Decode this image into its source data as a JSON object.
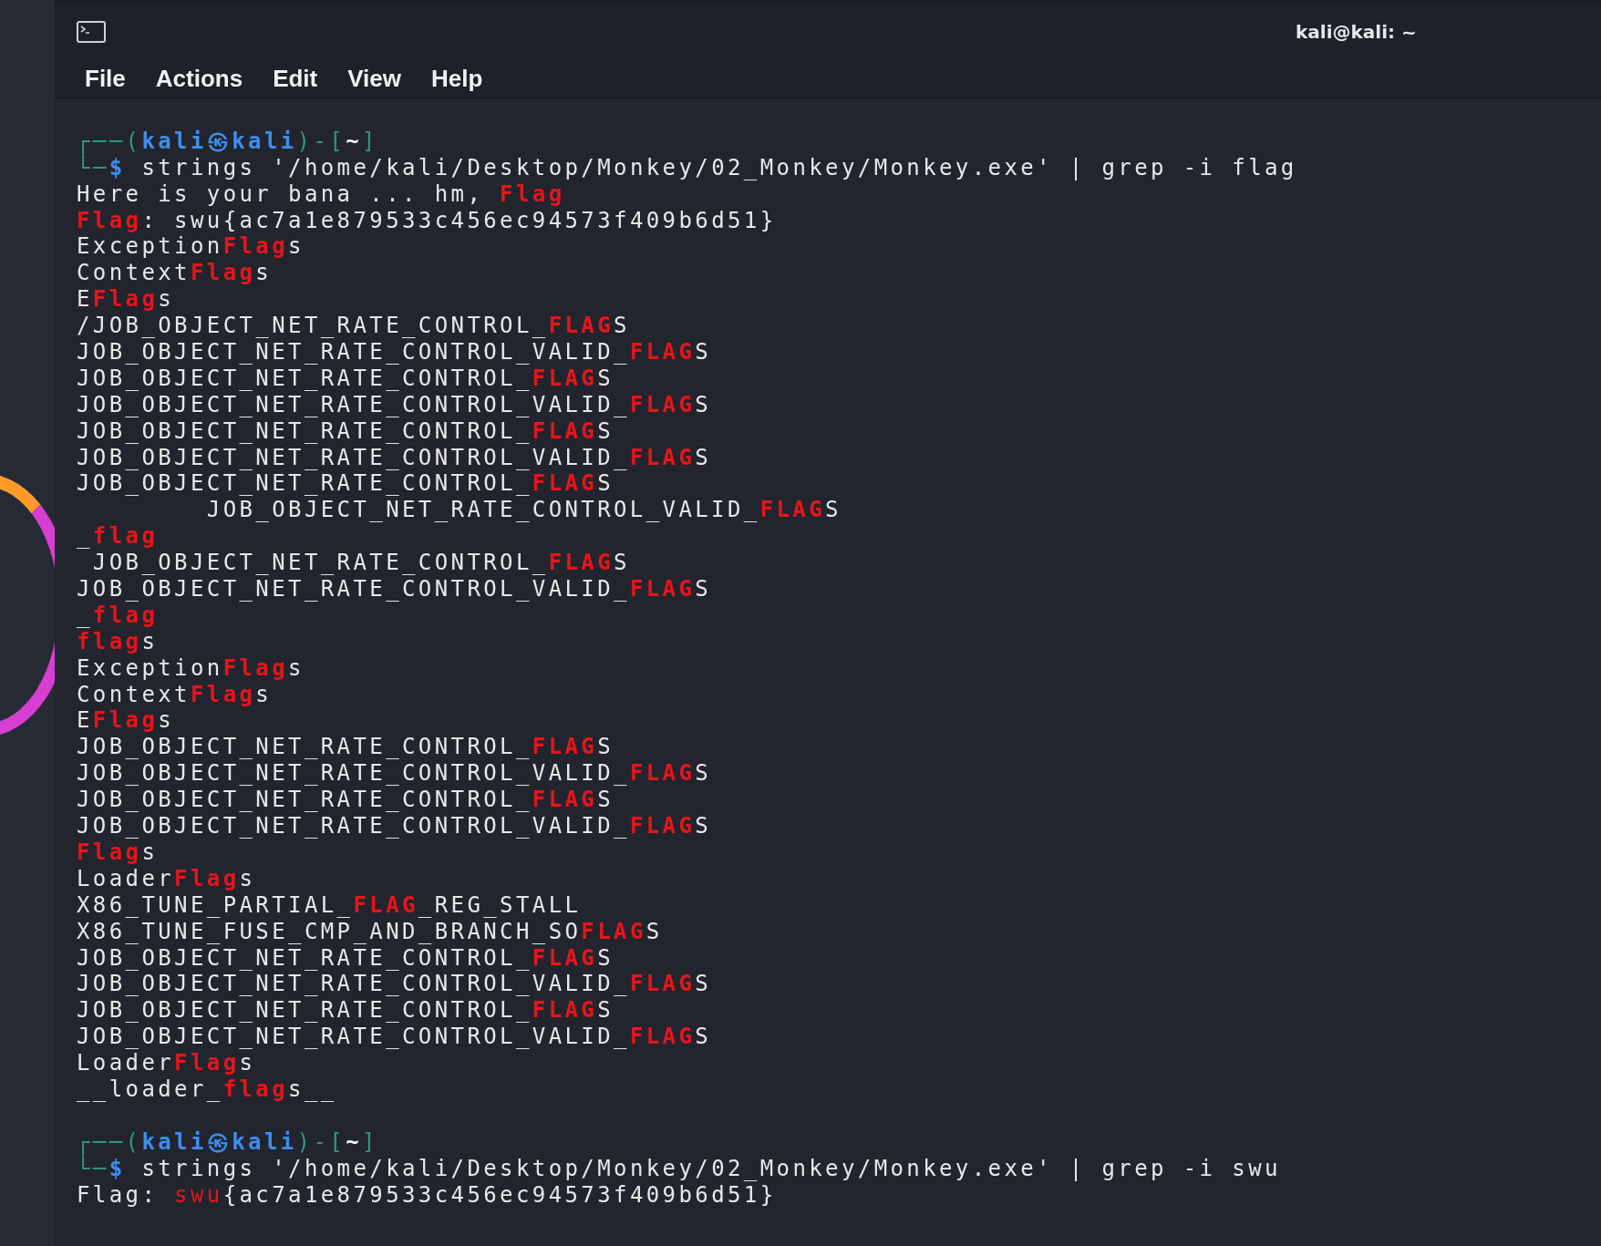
{
  "window": {
    "title": "kali@kali: ~"
  },
  "menu": [
    "File",
    "Actions",
    "Edit",
    "View",
    "Help"
  ],
  "terminal": {
    "lines": [
      {
        "kind": "prompt",
        "segments": [
          {
            "kind": "frame",
            "text": "┌──("
          },
          {
            "kind": "user",
            "text": "kali㉿kali"
          },
          {
            "kind": "frame",
            "text": ")-["
          },
          {
            "kind": "dir",
            "text": "~"
          },
          {
            "kind": "frame",
            "text": "]"
          }
        ]
      },
      {
        "kind": "command",
        "segments": [
          {
            "kind": "frame",
            "text": "└─"
          },
          {
            "kind": "user",
            "text": "$"
          },
          {
            "kind": "plain",
            "text": " strings '/home/kali/Desktop/Monkey/02_Monkey/Monkey.exe' | grep -i flag"
          }
        ]
      },
      {
        "kind": "output",
        "segments": [
          {
            "kind": "plain",
            "text": "Here is your bana ... hm, "
          },
          {
            "kind": "match",
            "text": "Flag"
          }
        ]
      },
      {
        "kind": "output",
        "segments": [
          {
            "kind": "match",
            "text": "Flag"
          },
          {
            "kind": "plain",
            "text": ": swu{ac7a1e879533c456ec94573f409b6d51}"
          }
        ]
      },
      {
        "kind": "output",
        "segments": [
          {
            "kind": "plain",
            "text": "Exception"
          },
          {
            "kind": "match",
            "text": "Flag"
          },
          {
            "kind": "plain",
            "text": "s"
          }
        ]
      },
      {
        "kind": "output",
        "segments": [
          {
            "kind": "plain",
            "text": "Context"
          },
          {
            "kind": "match",
            "text": "Flag"
          },
          {
            "kind": "plain",
            "text": "s"
          }
        ]
      },
      {
        "kind": "output",
        "segments": [
          {
            "kind": "plain",
            "text": "E"
          },
          {
            "kind": "match",
            "text": "Flag"
          },
          {
            "kind": "plain",
            "text": "s"
          }
        ]
      },
      {
        "kind": "output",
        "segments": [
          {
            "kind": "plain",
            "text": "/JOB_OBJECT_NET_RATE_CONTROL_"
          },
          {
            "kind": "match",
            "text": "FLAG"
          },
          {
            "kind": "plain",
            "text": "S"
          }
        ]
      },
      {
        "kind": "output",
        "segments": [
          {
            "kind": "plain",
            "text": "JOB_OBJECT_NET_RATE_CONTROL_VALID_"
          },
          {
            "kind": "match",
            "text": "FLAG"
          },
          {
            "kind": "plain",
            "text": "S"
          }
        ]
      },
      {
        "kind": "output",
        "segments": [
          {
            "kind": "plain",
            "text": "JOB_OBJECT_NET_RATE_CONTROL_"
          },
          {
            "kind": "match",
            "text": "FLAG"
          },
          {
            "kind": "plain",
            "text": "S"
          }
        ]
      },
      {
        "kind": "output",
        "segments": [
          {
            "kind": "plain",
            "text": "JOB_OBJECT_NET_RATE_CONTROL_VALID_"
          },
          {
            "kind": "match",
            "text": "FLAG"
          },
          {
            "kind": "plain",
            "text": "S"
          }
        ]
      },
      {
        "kind": "output",
        "segments": [
          {
            "kind": "plain",
            "text": "JOB_OBJECT_NET_RATE_CONTROL_"
          },
          {
            "kind": "match",
            "text": "FLAG"
          },
          {
            "kind": "plain",
            "text": "S"
          }
        ]
      },
      {
        "kind": "output",
        "segments": [
          {
            "kind": "plain",
            "text": "JOB_OBJECT_NET_RATE_CONTROL_VALID_"
          },
          {
            "kind": "match",
            "text": "FLAG"
          },
          {
            "kind": "plain",
            "text": "S"
          }
        ]
      },
      {
        "kind": "output",
        "segments": [
          {
            "kind": "plain",
            "text": "JOB_OBJECT_NET_RATE_CONTROL_"
          },
          {
            "kind": "match",
            "text": "FLAG"
          },
          {
            "kind": "plain",
            "text": "S"
          }
        ]
      },
      {
        "kind": "output",
        "segments": [
          {
            "kind": "plain",
            "text": "        JOB_OBJECT_NET_RATE_CONTROL_VALID_"
          },
          {
            "kind": "match",
            "text": "FLAG"
          },
          {
            "kind": "plain",
            "text": "S"
          }
        ]
      },
      {
        "kind": "output",
        "segments": [
          {
            "kind": "plain",
            "text": "_"
          },
          {
            "kind": "match",
            "text": "flag"
          }
        ]
      },
      {
        "kind": "output",
        "segments": [
          {
            "kind": "plain",
            "text": " JOB_OBJECT_NET_RATE_CONTROL_"
          },
          {
            "kind": "match",
            "text": "FLAG"
          },
          {
            "kind": "plain",
            "text": "S"
          }
        ]
      },
      {
        "kind": "output",
        "segments": [
          {
            "kind": "plain",
            "text": "JOB_OBJECT_NET_RATE_CONTROL_VALID_"
          },
          {
            "kind": "match",
            "text": "FLAG"
          },
          {
            "kind": "plain",
            "text": "S"
          }
        ]
      },
      {
        "kind": "output",
        "segments": [
          {
            "kind": "plain",
            "text": "_"
          },
          {
            "kind": "match",
            "text": "flag"
          }
        ]
      },
      {
        "kind": "output",
        "segments": [
          {
            "kind": "match",
            "text": "flag"
          },
          {
            "kind": "plain",
            "text": "s"
          }
        ]
      },
      {
        "kind": "output",
        "segments": [
          {
            "kind": "plain",
            "text": "Exception"
          },
          {
            "kind": "match",
            "text": "Flag"
          },
          {
            "kind": "plain",
            "text": "s"
          }
        ]
      },
      {
        "kind": "output",
        "segments": [
          {
            "kind": "plain",
            "text": "Context"
          },
          {
            "kind": "match",
            "text": "Flag"
          },
          {
            "kind": "plain",
            "text": "s"
          }
        ]
      },
      {
        "kind": "output",
        "segments": [
          {
            "kind": "plain",
            "text": "E"
          },
          {
            "kind": "match",
            "text": "Flag"
          },
          {
            "kind": "plain",
            "text": "s"
          }
        ]
      },
      {
        "kind": "output",
        "segments": [
          {
            "kind": "plain",
            "text": "JOB_OBJECT_NET_RATE_CONTROL_"
          },
          {
            "kind": "match",
            "text": "FLAG"
          },
          {
            "kind": "plain",
            "text": "S"
          }
        ]
      },
      {
        "kind": "output",
        "segments": [
          {
            "kind": "plain",
            "text": "JOB_OBJECT_NET_RATE_CONTROL_VALID_"
          },
          {
            "kind": "match",
            "text": "FLAG"
          },
          {
            "kind": "plain",
            "text": "S"
          }
        ]
      },
      {
        "kind": "output",
        "segments": [
          {
            "kind": "plain",
            "text": "JOB_OBJECT_NET_RATE_CONTROL_"
          },
          {
            "kind": "match",
            "text": "FLAG"
          },
          {
            "kind": "plain",
            "text": "S"
          }
        ]
      },
      {
        "kind": "output",
        "segments": [
          {
            "kind": "plain",
            "text": "JOB_OBJECT_NET_RATE_CONTROL_VALID_"
          },
          {
            "kind": "match",
            "text": "FLAG"
          },
          {
            "kind": "plain",
            "text": "S"
          }
        ]
      },
      {
        "kind": "output",
        "segments": [
          {
            "kind": "match",
            "text": "Flag"
          },
          {
            "kind": "plain",
            "text": "s"
          }
        ]
      },
      {
        "kind": "output",
        "segments": [
          {
            "kind": "plain",
            "text": "Loader"
          },
          {
            "kind": "match",
            "text": "Flag"
          },
          {
            "kind": "plain",
            "text": "s"
          }
        ]
      },
      {
        "kind": "output",
        "segments": [
          {
            "kind": "plain",
            "text": "X86_TUNE_PARTIAL_"
          },
          {
            "kind": "match",
            "text": "FLAG"
          },
          {
            "kind": "plain",
            "text": "_REG_STALL"
          }
        ]
      },
      {
        "kind": "output",
        "segments": [
          {
            "kind": "plain",
            "text": "X86_TUNE_FUSE_CMP_AND_BRANCH_SO"
          },
          {
            "kind": "match",
            "text": "FLAG"
          },
          {
            "kind": "plain",
            "text": "S"
          }
        ]
      },
      {
        "kind": "output",
        "segments": [
          {
            "kind": "plain",
            "text": "JOB_OBJECT_NET_RATE_CONTROL_"
          },
          {
            "kind": "match",
            "text": "FLAG"
          },
          {
            "kind": "plain",
            "text": "S"
          }
        ]
      },
      {
        "kind": "output",
        "segments": [
          {
            "kind": "plain",
            "text": "JOB_OBJECT_NET_RATE_CONTROL_VALID_"
          },
          {
            "kind": "match",
            "text": "FLAG"
          },
          {
            "kind": "plain",
            "text": "S"
          }
        ]
      },
      {
        "kind": "output",
        "segments": [
          {
            "kind": "plain",
            "text": "JOB_OBJECT_NET_RATE_CONTROL_"
          },
          {
            "kind": "match",
            "text": "FLAG"
          },
          {
            "kind": "plain",
            "text": "S"
          }
        ]
      },
      {
        "kind": "output",
        "segments": [
          {
            "kind": "plain",
            "text": "JOB_OBJECT_NET_RATE_CONTROL_VALID_"
          },
          {
            "kind": "match",
            "text": "FLAG"
          },
          {
            "kind": "plain",
            "text": "S"
          }
        ]
      },
      {
        "kind": "output",
        "segments": [
          {
            "kind": "plain",
            "text": "Loader"
          },
          {
            "kind": "match",
            "text": "Flag"
          },
          {
            "kind": "plain",
            "text": "s"
          }
        ]
      },
      {
        "kind": "output",
        "segments": [
          {
            "kind": "plain",
            "text": "__loader_"
          },
          {
            "kind": "match",
            "text": "flag"
          },
          {
            "kind": "plain",
            "text": "s__"
          }
        ]
      },
      {
        "kind": "prompt",
        "segments": [
          {
            "kind": "frame",
            "text": "┌──("
          },
          {
            "kind": "user",
            "text": "kali㉿kali"
          },
          {
            "kind": "frame",
            "text": ")-["
          },
          {
            "kind": "dir",
            "text": "~"
          },
          {
            "kind": "frame",
            "text": "]"
          }
        ]
      },
      {
        "kind": "command",
        "segments": [
          {
            "kind": "frame",
            "text": "└─"
          },
          {
            "kind": "user",
            "text": "$"
          },
          {
            "kind": "plain",
            "text": " strings '/home/kali/Desktop/Monkey/02_Monkey/Monkey.exe' | grep -i swu"
          }
        ]
      },
      {
        "kind": "output",
        "segments": [
          {
            "kind": "plain",
            "text": "Flag: "
          },
          {
            "kind": "hit",
            "text": "swu"
          },
          {
            "kind": "plain",
            "text": "{ac7a1e879533c456ec94573f409b6d51}"
          }
        ]
      }
    ]
  }
}
